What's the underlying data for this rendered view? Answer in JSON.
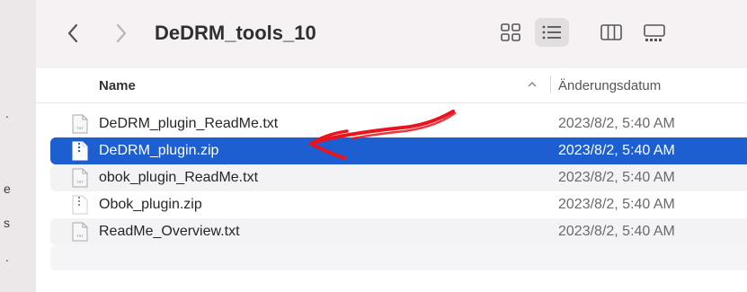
{
  "window": {
    "title": "DeDRM_tools_10"
  },
  "toolbar": {
    "back_icon": "chevron-left-icon",
    "forward_icon": "chevron-right-icon",
    "view_icons": [
      "icon-view-grid-icon",
      "list-view-icon",
      "column-view-icon",
      "gallery-view-icon"
    ]
  },
  "sidebar": {
    "fragments": [
      "e",
      "s"
    ]
  },
  "columns": {
    "name": "Name",
    "date": "Änderungsdatum"
  },
  "files": [
    {
      "name": "DeDRM_plugin_ReadMe.txt",
      "date": "2023/8/2, 5:40 AM",
      "type": "txt"
    },
    {
      "name": "DeDRM_plugin.zip",
      "date": "2023/8/2, 5:40 AM",
      "type": "zip",
      "selected": true
    },
    {
      "name": "obok_plugin_ReadMe.txt",
      "date": "2023/8/2, 5:40 AM",
      "type": "txt"
    },
    {
      "name": "Obok_plugin.zip",
      "date": "2023/8/2, 5:40 AM",
      "type": "zip"
    },
    {
      "name": "ReadMe_Overview.txt",
      "date": "2023/8/2, 5:40 AM",
      "type": "txt"
    }
  ],
  "colors": {
    "selection": "#1d5fd1",
    "annotation": "#e8141e"
  }
}
